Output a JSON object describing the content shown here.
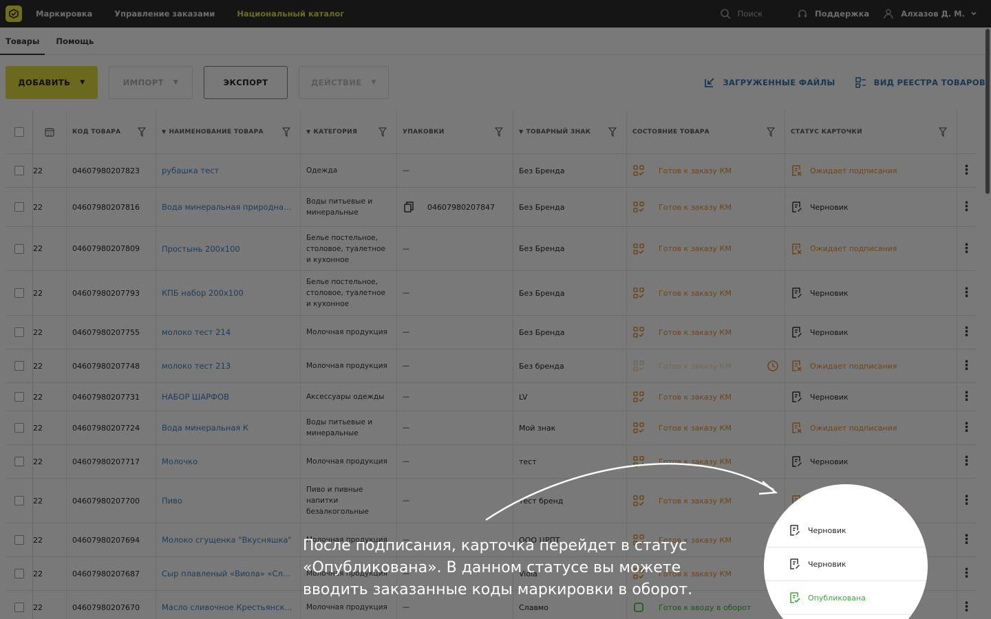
{
  "topbar": {
    "nav": [
      "Маркировка",
      "Управление заказами",
      "Национальный каталог"
    ],
    "active_nav": 2,
    "search": "Поиск",
    "support": "Поддержка",
    "user": "Алхазов Д. М."
  },
  "tabs": [
    "Товары",
    "Помощь"
  ],
  "toolbar": {
    "add": "ДОБАВИТЬ",
    "import": "ИМПОРТ",
    "export": "ЭКСПОРТ",
    "action": "ДЕЙСТВИЕ",
    "uploaded_files": "ЗАГРУЖЕННЫЕ ФАЙЛЫ",
    "registry_view": "ВИД РЕЕСТРА ТОВАРОВ"
  },
  "columns": {
    "code": "КОД ТОВАРА",
    "name": "НАИМЕНОВАНИЕ ТОВАРА",
    "category": "КАТЕГОРИЯ",
    "packages": "УПАКОВКИ",
    "brand": "ТОВАРНЫЙ ЗНАК",
    "state": "СОСТОЯНИЕ ТОВАРА",
    "status": "СТАТУС КАРТОЧКИ"
  },
  "rows": [
    {
      "date": "22",
      "code": "04607980207823",
      "name": "рубашка тест",
      "category": "Одежда",
      "pack": "—",
      "brand": "Без Бренда",
      "state": "Готов к заказу КМ",
      "status": "Ожидает подписания"
    },
    {
      "date": "22",
      "code": "04607980207816",
      "name": "Вода минеральная природная...",
      "category": "Воды питьевые и минеральные",
      "pack": "04607980207847",
      "brand": "Без Бренда",
      "state": "Готов к заказу КМ",
      "status": "Черновик"
    },
    {
      "date": "22",
      "code": "04607980207809",
      "name": "Простынь 200x100",
      "category": "Белье постельное, столовое, туалетное и кухонное",
      "pack": "—",
      "brand": "Без Бренда",
      "state": "Готов к заказу КМ",
      "status": "Ожидает подписания"
    },
    {
      "date": "22",
      "code": "04607980207793",
      "name": "КПБ набор 200х100",
      "category": "Белье постельное, столовое, туалетное и кухонное",
      "pack": "—",
      "brand": "Без Бренда",
      "state": "Готов к заказу КМ",
      "status": "Черновик"
    },
    {
      "date": "22",
      "code": "04607980207755",
      "name": "молоко тест 214",
      "category": "Молочная продукция",
      "pack": "—",
      "brand": "Без Бренда",
      "state": "Готов к заказу КМ",
      "status": "Черновик"
    },
    {
      "date": "22",
      "code": "04607980207748",
      "name": "молоко тест 213",
      "category": "Молочная продукция",
      "pack": "—",
      "brand": "Без бренда",
      "state": "Готов к заказу КМ",
      "status": "Ожидает подписания"
    },
    {
      "date": "22",
      "code": "04607980207731",
      "name": "НАБОР ШАРФОВ",
      "category": "Аксессуары одежды",
      "pack": "—",
      "brand": "LV",
      "state": "Готов к заказу КМ",
      "status": "Черновик"
    },
    {
      "date": "22",
      "code": "04607980207724",
      "name": "Вода минеральная К",
      "category": "Воды питьевые и минеральные",
      "pack": "—",
      "brand": "Мой знак",
      "state": "Готов к заказу КМ",
      "status": "Ожидает подписания"
    },
    {
      "date": "22",
      "code": "04607980207717",
      "name": "Молочко",
      "category": "Молочная продукция",
      "pack": "—",
      "brand": "тест",
      "state": "Готов к заказу КМ",
      "status": "Черновик"
    },
    {
      "date": "22",
      "code": "04607980207700",
      "name": "Пиво",
      "category": "Пиво и пивные напитки безалкогольные",
      "pack": "—",
      "brand": "тест бренд",
      "state": "Готов к заказу КМ",
      "status": "Ожидает подписания"
    },
    {
      "date": "22",
      "code": "04607980207694",
      "name": "Молоко сгущенка \"Вкусняшка\"",
      "category": "Молочная продукция",
      "pack": "—",
      "brand": "ООО ЦРПТ",
      "state": "Готов к заказу КМ",
      "status": "Черновик"
    },
    {
      "date": "22",
      "code": "04607980207687",
      "name": "Сыр плавленый «Виола» «Сли...",
      "category": "Молочная продукция",
      "pack": "—",
      "brand": "Viola",
      "state": "Готов к заказу КМ",
      "status": "Черновик"
    },
    {
      "date": "22",
      "code": "04607980207670",
      "name": "Масло сливочное Крестьянск...",
      "category": "Молочная продукция",
      "pack": "—",
      "brand": "Славмо",
      "state": "Готов к вводу в оборот",
      "status": "Опубликована"
    }
  ],
  "overlay": {
    "caption_lines": [
      "После подписания, карточка перейдет в статус",
      "«Опубликована». В данном статусе вы можете",
      "вводить заказанные коды маркировки в оборот."
    ],
    "spot_rows": [
      "Черновик",
      "Черновик",
      "Опубликована"
    ]
  },
  "colors": {
    "accent_yellow": "#d4d33a",
    "link_blue": "#3a7ab8",
    "orange": "#e0892a",
    "green": "#3aaa35"
  }
}
